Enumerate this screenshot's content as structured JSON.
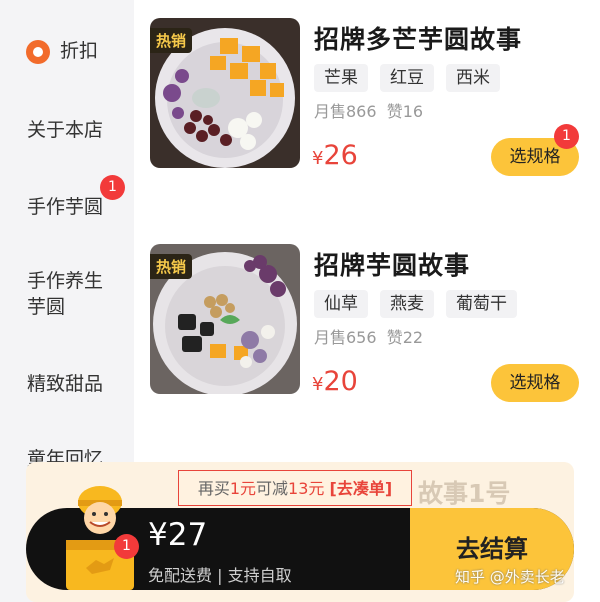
{
  "sidebar": {
    "items": [
      {
        "label": "折扣"
      },
      {
        "label": "关于本店"
      },
      {
        "label": "手作芋圆",
        "badge": "1"
      },
      {
        "label": "手作养生芋圆"
      },
      {
        "label": "精致甜品"
      },
      {
        "label": "童年回忆"
      }
    ]
  },
  "products": [
    {
      "hot": "热销",
      "name": "招牌多芒芋圆故事",
      "tags": [
        "芒果",
        "红豆",
        "西米"
      ],
      "monthly": "月售866",
      "likes": "赞16",
      "currency": "¥",
      "price": "26",
      "button": "选规格",
      "cart_badge": "1"
    },
    {
      "hot": "热销",
      "name": "招牌芋圆故事",
      "tags": [
        "仙草",
        "燕麦",
        "葡萄干"
      ],
      "monthly": "月售656",
      "likes": "赞22",
      "currency": "¥",
      "price": "20",
      "button": "选规格"
    }
  ],
  "promo": {
    "prefix": "再买",
    "amount": "1元",
    "middle": "可减",
    "discount": "13元",
    "link": "[去凑单]",
    "hidden_text": "故事1号"
  },
  "cart": {
    "total": "¥27",
    "fee_note": "免配送费 | 支持自取",
    "badge": "1",
    "checkout": "去结算"
  },
  "watermark": "知乎 @外卖长老",
  "colors": {
    "accent": "#fcc43a",
    "price": "#e8443a",
    "badge": "#f23a3a"
  }
}
